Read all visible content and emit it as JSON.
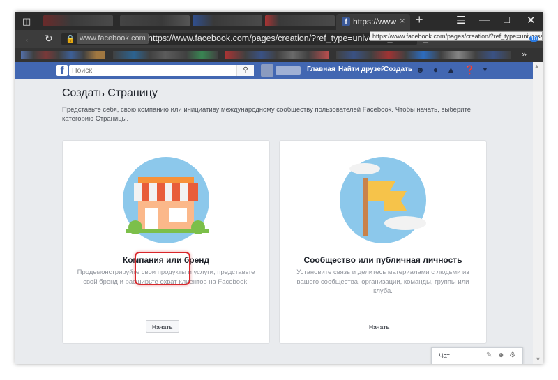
{
  "browser": {
    "tab_title": "https://www.face",
    "url_domain": "www.facebook.com",
    "url": "https://www.facebook.com/pages/creation/?ref_type=universal_creation_hu",
    "url_tooltip": "https://www.facebook.com/pages/creation/?ref_type=universal_c",
    "ext_badge": "10"
  },
  "fb_header": {
    "search_placeholder": "Поиск",
    "nav_home": "Главная",
    "nav_find_friends": "Найти друзей",
    "nav_create": "Создать"
  },
  "page": {
    "title": "Создать Страницу",
    "description": "Представьте себя, свою компанию или инициативу международному сообществу пользователей Facebook. Чтобы начать, выберите категорию Страницы."
  },
  "cards": [
    {
      "title": "Компания или бренд",
      "description": "Продемонстрируйте свои продукты и услуги, представьте свой бренд и расширьте охват клиентов на Facebook.",
      "button": "Начать"
    },
    {
      "title": "Сообщество или публичная личность",
      "description": "Установите связь и делитесь материалами с людьми из вашего сообщества, организации, команды, группы или клуба.",
      "button": "Начать"
    }
  ],
  "chat": {
    "label": "Чат"
  },
  "colors": {
    "fb_blue": "#4267b2",
    "page_bg": "#e9ebee",
    "highlight": "#d9262a",
    "illustration_bg": "#8cc8eb"
  }
}
